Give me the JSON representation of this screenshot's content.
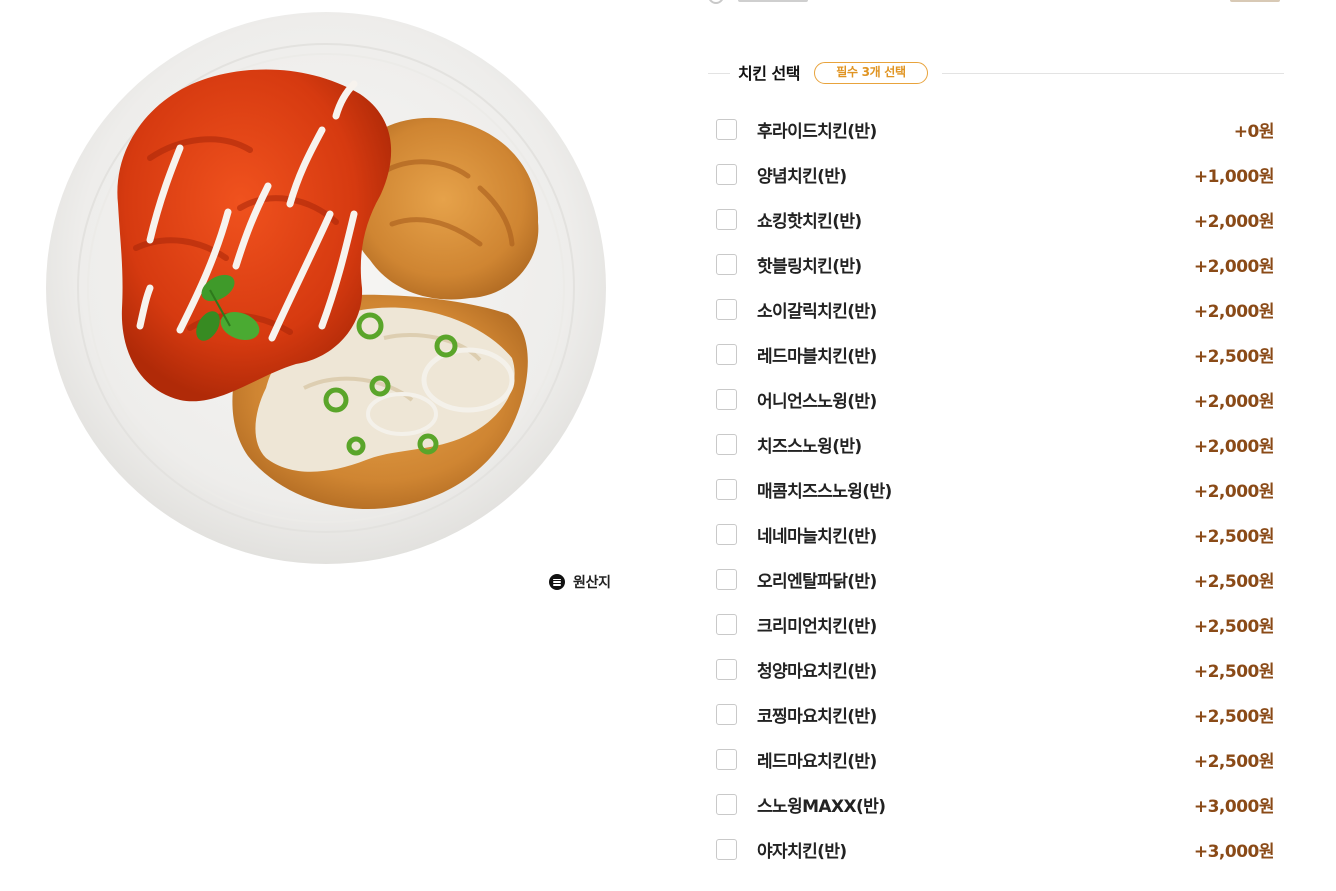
{
  "product": {
    "image_alt": "chicken plate",
    "origin_label": "원산지"
  },
  "section": {
    "title": "치킨 선택",
    "badge": "필수 3개 선택"
  },
  "options": [
    {
      "name": "후라이드치킨(반)",
      "price": "+0원"
    },
    {
      "name": "양념치킨(반)",
      "price": "+1,000원"
    },
    {
      "name": "쇼킹핫치킨(반)",
      "price": "+2,000원"
    },
    {
      "name": "핫블링치킨(반)",
      "price": "+2,000원"
    },
    {
      "name": "소이갈릭치킨(반)",
      "price": "+2,000원"
    },
    {
      "name": "레드마블치킨(반)",
      "price": "+2,500원"
    },
    {
      "name": "어니언스노윙(반)",
      "price": "+2,000원"
    },
    {
      "name": "치즈스노윙(반)",
      "price": "+2,000원"
    },
    {
      "name": "매콤치즈스노윙(반)",
      "price": "+2,000원"
    },
    {
      "name": "네네마늘치킨(반)",
      "price": "+2,500원"
    },
    {
      "name": "오리엔탈파닭(반)",
      "price": "+2,500원"
    },
    {
      "name": "크리미언치킨(반)",
      "price": "+2,500원"
    },
    {
      "name": "청양마요치킨(반)",
      "price": "+2,500원"
    },
    {
      "name": "코찡마요치킨(반)",
      "price": "+2,500원"
    },
    {
      "name": "레드마요치킨(반)",
      "price": "+2,500원"
    },
    {
      "name": "스노윙MAXX(반)",
      "price": "+3,000원"
    },
    {
      "name": "야자치킨(반)",
      "price": "+3,000원"
    }
  ],
  "colors": {
    "accent": "#e8a33c",
    "price": "#8a4a17",
    "checkbox_border": "#c9c9c9"
  }
}
